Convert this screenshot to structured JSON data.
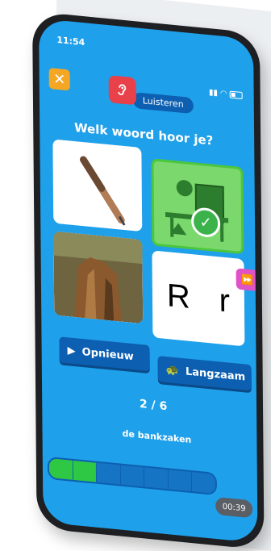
{
  "status": {
    "time": "11:54"
  },
  "header": {
    "close_icon": "✕",
    "mode_label": "Luisteren"
  },
  "question": "Welk woord hoor je?",
  "cards": [
    {
      "name": "pen",
      "selected": false
    },
    {
      "name": "bank-cash",
      "selected": true
    },
    {
      "name": "tree-stump",
      "selected": false
    },
    {
      "name": "letters",
      "upper": "R",
      "lower": "r",
      "selected": false
    }
  ],
  "buttons": {
    "replay_label": "Opnieuw",
    "slow_label": "Langzaam"
  },
  "progress": {
    "current": 2,
    "total": 6,
    "counter_text": "2 / 6",
    "segments_done": 2,
    "segments_total": 7
  },
  "word": "de bankzaken",
  "timer": "00:39",
  "colors": {
    "screen": "#1fa0ea",
    "accent_blue": "#0d5fb1",
    "correct_green": "#4cc63d",
    "close_orange": "#f5a623",
    "ear_red": "#e8414a",
    "side_tab_pink": "#e052c7"
  }
}
